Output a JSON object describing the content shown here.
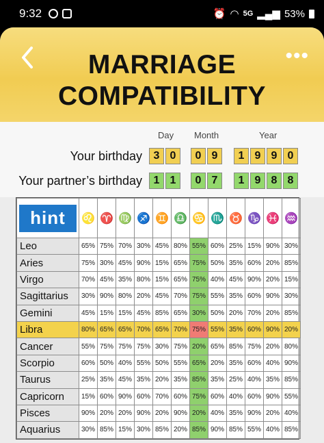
{
  "status_bar": {
    "time": "9:32",
    "network": "5G",
    "battery": "53%"
  },
  "header": {
    "title_line1": "MARRIAGE",
    "title_line2": "COMPATIBILITY",
    "more_label": "•••"
  },
  "birthday_form": {
    "col_day": "Day",
    "col_month": "Month",
    "col_year": "Year",
    "your_label": "Your birthday",
    "partner_label": "Your partner’s birthday",
    "your_digits": {
      "day": [
        "3",
        "0"
      ],
      "month": [
        "0",
        "9"
      ],
      "year": [
        "1",
        "9",
        "9",
        "0"
      ]
    },
    "partner_digits": {
      "day": [
        "1",
        "1"
      ],
      "month": [
        "0",
        "7"
      ],
      "year": [
        "1",
        "9",
        "8",
        "8"
      ]
    }
  },
  "table": {
    "hint_label": "hint",
    "symbols": [
      "♌",
      "♈",
      "♍",
      "♐",
      "♊",
      "♎",
      "♋",
      "♏",
      "♉",
      "♑",
      "♓",
      "♒"
    ],
    "highlight_row": 5,
    "highlight_col": 6,
    "green_col": 6,
    "rows": [
      {
        "sign": "Leo",
        "values": [
          "65%",
          "75%",
          "70%",
          "30%",
          "45%",
          "80%",
          "55%",
          "60%",
          "25%",
          "15%",
          "90%",
          "30%"
        ]
      },
      {
        "sign": "Aries",
        "values": [
          "75%",
          "30%",
          "45%",
          "90%",
          "15%",
          "65%",
          "75%",
          "50%",
          "35%",
          "60%",
          "20%",
          "85%"
        ]
      },
      {
        "sign": "Virgo",
        "values": [
          "70%",
          "45%",
          "35%",
          "80%",
          "15%",
          "65%",
          "75%",
          "40%",
          "45%",
          "90%",
          "20%",
          "15%"
        ]
      },
      {
        "sign": "Sagittarius",
        "values": [
          "30%",
          "90%",
          "80%",
          "20%",
          "45%",
          "70%",
          "75%",
          "55%",
          "35%",
          "60%",
          "90%",
          "30%"
        ]
      },
      {
        "sign": "Gemini",
        "values": [
          "45%",
          "15%",
          "15%",
          "45%",
          "85%",
          "65%",
          "30%",
          "50%",
          "20%",
          "70%",
          "20%",
          "85%"
        ]
      },
      {
        "sign": "Libra",
        "values": [
          "80%",
          "65%",
          "65%",
          "70%",
          "65%",
          "70%",
          "75%",
          "55%",
          "35%",
          "60%",
          "90%",
          "20%"
        ]
      },
      {
        "sign": "Cancer",
        "values": [
          "55%",
          "75%",
          "75%",
          "75%",
          "30%",
          "75%",
          "20%",
          "65%",
          "85%",
          "75%",
          "20%",
          "80%"
        ]
      },
      {
        "sign": "Scorpio",
        "values": [
          "60%",
          "50%",
          "40%",
          "55%",
          "50%",
          "55%",
          "65%",
          "20%",
          "35%",
          "60%",
          "40%",
          "90%"
        ]
      },
      {
        "sign": "Taurus",
        "values": [
          "25%",
          "35%",
          "45%",
          "35%",
          "20%",
          "35%",
          "85%",
          "35%",
          "25%",
          "40%",
          "35%",
          "85%"
        ]
      },
      {
        "sign": "Capricorn",
        "values": [
          "15%",
          "60%",
          "90%",
          "60%",
          "70%",
          "60%",
          "75%",
          "60%",
          "40%",
          "60%",
          "90%",
          "55%"
        ]
      },
      {
        "sign": "Pisces",
        "values": [
          "90%",
          "20%",
          "20%",
          "90%",
          "20%",
          "90%",
          "20%",
          "40%",
          "35%",
          "90%",
          "20%",
          "40%"
        ]
      },
      {
        "sign": "Aquarius",
        "values": [
          "30%",
          "85%",
          "15%",
          "30%",
          "85%",
          "20%",
          "85%",
          "90%",
          "85%",
          "55%",
          "40%",
          "85%"
        ]
      }
    ]
  }
}
